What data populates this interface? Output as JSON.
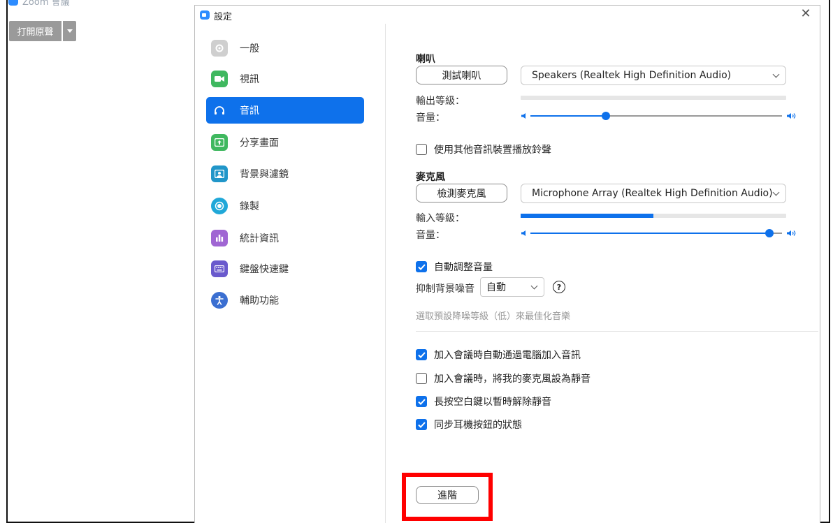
{
  "background": {
    "app_title": "Zoom 會議",
    "open_audio_button": "打開原聲"
  },
  "window": {
    "title": "設定"
  },
  "sidebar": {
    "items": [
      {
        "label": "一般",
        "icon": "gear-icon",
        "color": "#c8c8c8"
      },
      {
        "label": "視訊",
        "icon": "video-icon",
        "color": "#3fb85f"
      },
      {
        "label": "音訊",
        "icon": "headphone-icon",
        "color": "#0e71eb"
      },
      {
        "label": "分享畫面",
        "icon": "share-screen-icon",
        "color": "#3fb85f"
      },
      {
        "label": "背景與濾鏡",
        "icon": "background-icon",
        "color": "#2196c9"
      },
      {
        "label": "錄製",
        "icon": "record-icon",
        "color": "#20a8d8"
      },
      {
        "label": "統計資訊",
        "icon": "statistics-icon",
        "color": "#a066d3"
      },
      {
        "label": "鍵盤快速鍵",
        "icon": "keyboard-icon",
        "color": "#6a5acd"
      },
      {
        "label": "輔助功能",
        "icon": "accessibility-icon",
        "color": "#3b6fd1"
      }
    ],
    "active_index": 2
  },
  "speaker": {
    "title": "喇叭",
    "test_button": "測試喇叭",
    "device": "Speakers (Realtek High Definition Audio)",
    "output_level_label": "輸出等級：",
    "output_level": 0,
    "volume_label": "音量：",
    "volume": 0.3
  },
  "use_separate_ringtone": {
    "label": "使用其他音訊裝置播放鈴聲",
    "checked": false
  },
  "microphone": {
    "title": "麥克風",
    "test_button": "檢測麥克風",
    "device": "Microphone Array (Realtek High Definition Audio)",
    "input_level_label": "輸入等級：",
    "input_level": 0.5,
    "volume_label": "音量：",
    "volume": 0.95
  },
  "auto_adjust": {
    "label": "自動調整音量",
    "checked": true
  },
  "noise_suppression": {
    "label": "抑制背景噪音",
    "value": "自動",
    "help": "?"
  },
  "hint": "選取預設降噪等級（低）來最佳化音樂",
  "options": [
    {
      "label": "加入會議時自動通過電腦加入音訊",
      "checked": true
    },
    {
      "label": "加入會議時，將我的麥克風設為靜音",
      "checked": false
    },
    {
      "label": "長按空白鍵以暫時解除靜音",
      "checked": true
    },
    {
      "label": "同步耳機按鈕的狀態",
      "checked": true
    }
  ],
  "advanced_button": "進階",
  "colors": {
    "accent": "#0e71eb",
    "highlight": "#ff0000"
  }
}
